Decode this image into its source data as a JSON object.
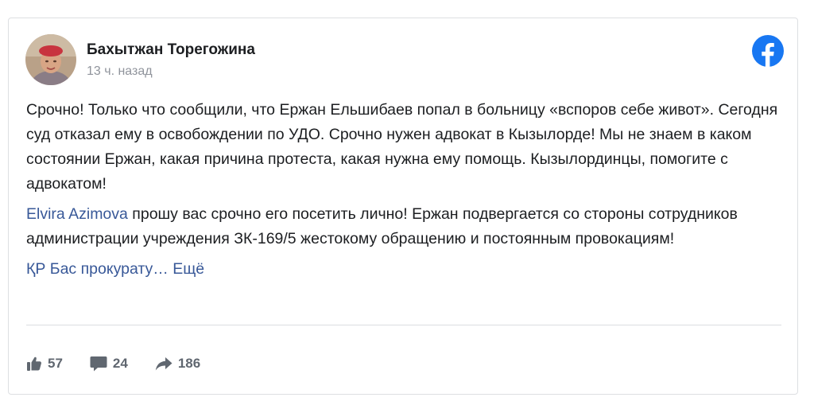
{
  "post": {
    "author": "Бахытжан Торегожина",
    "time": "13 ч. назад",
    "source_icon": "facebook-icon",
    "paragraph1": "Срочно! Только что сообщили, что Ержан Ельшибаев попал в больницу «вспоров себе живот». Сегодня суд отказал ему в освобождении по УДО. Срочно нужен адвокат в Кызылорде! Мы не знаем в каком состоянии Ержан, какая причина протеста, какая нужна ему помощь. Кызылординцы, помогите с адвокатом!",
    "mention": "Elvira Azimova",
    "paragraph2_text": " прошу вас срочно его посетить лично! Ержан подвергается со стороны сотрудников администрации учреждения ЗК-169/5 жестокому обращению и постоянным провокациям!",
    "truncated_link": "ҚР Бас прокурату…",
    "more_label": "Ещё"
  },
  "stats": {
    "likes": "57",
    "comments": "24",
    "shares": "186"
  },
  "colors": {
    "link": "#385898",
    "facebook_brand": "#1877f2",
    "secondary_text": "#90949c",
    "stat_text": "#606770"
  }
}
